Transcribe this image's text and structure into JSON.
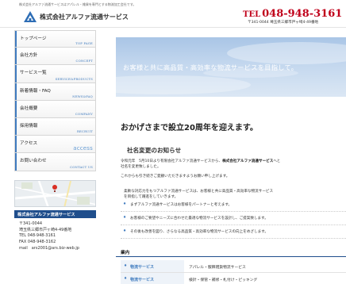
{
  "header": {
    "tagline": "株式会社アルファ流通サービスはアパレル・雑貨を専門とする物流加工会社です。",
    "company_name": "株式会社アルファ流通サービス",
    "logo_icon": "triangle-logo-icon",
    "tel_prefix": "TEL",
    "tel_number": "048-948-3161",
    "address": "〒341-0044 埼玉県三郷市戸ヶ崎4-49番地"
  },
  "nav": {
    "items": [
      {
        "label": "トップページ",
        "sub": "TOP PAGE"
      },
      {
        "label": "会社方針",
        "sub": "CONCEPT"
      },
      {
        "label": "サービス一覧",
        "sub": "SERVICE&PRODUCTS"
      },
      {
        "label": "新着情報・FAQ",
        "sub": "NEWS&FAQ"
      },
      {
        "label": "会社概要",
        "sub": "COMPANY"
      },
      {
        "label": "採用情報",
        "sub": "RECRUIT"
      },
      {
        "label": "アクセス",
        "sub": "access"
      },
      {
        "label": "お問い合わせ",
        "sub": "CONTACT US"
      }
    ]
  },
  "sidebar_info": {
    "title": "株式会社アルファ流通サービス",
    "postal": "〒341-0044",
    "address": "埼玉県三郷市戸ヶ崎4-49番地",
    "tel": "TEL 048-948-3161",
    "fax": "FAX 048-948-3162",
    "mail": "mail　ars2001@ars.biz-web.jp"
  },
  "hero": {
    "text": "お客様と共に高品質・高効率な物流サービスを目指して。"
  },
  "main": {
    "anniversary": "おかげさまで設立20周年を迎えます。",
    "subtitle": "社名変更のお知らせ",
    "para1_line1_a": "令和元年　5月10日より有限会社アルファ流通サービスから、",
    "para1_line1_b": "株式会社アルファ流通サービス",
    "para1_line1_c": "へと",
    "para1_line2": "社名を変更致しました。",
    "para2": "これからも引き続きご愛顧いただきますようお願い申し上げます。",
    "para3_line1": "柔軟な対応力をもつアルファ流通サービスは、お客様と共に高品質・高効率な物流サービス",
    "para3_line2": "を目指して躍進をしていきます。",
    "bullet_mark": "♦",
    "bullets": [
      "まずアルファ流通サービスはお客様をパートナーと考えます。",
      "お客様のご要望やニーズに合わせた最適な物流サービスを設計し、ご提案致します。",
      "その後も改善を図り、さらなる高品質・高効率な物流サービスの向上をめざします。"
    ]
  },
  "business": {
    "heading": "業内",
    "mark": "♦",
    "rows": [
      {
        "name": "物流サービス",
        "desc": "アパレル・服飾雑貨物流サービス"
      },
      {
        "name": "物流サービス",
        "desc": "検針・保管・補修・札付け・ピッキング"
      }
    ]
  },
  "colors": {
    "accent_blue": "#1f4e8c",
    "link_blue": "#3f7bbf",
    "tel_red": "#c0001a"
  }
}
